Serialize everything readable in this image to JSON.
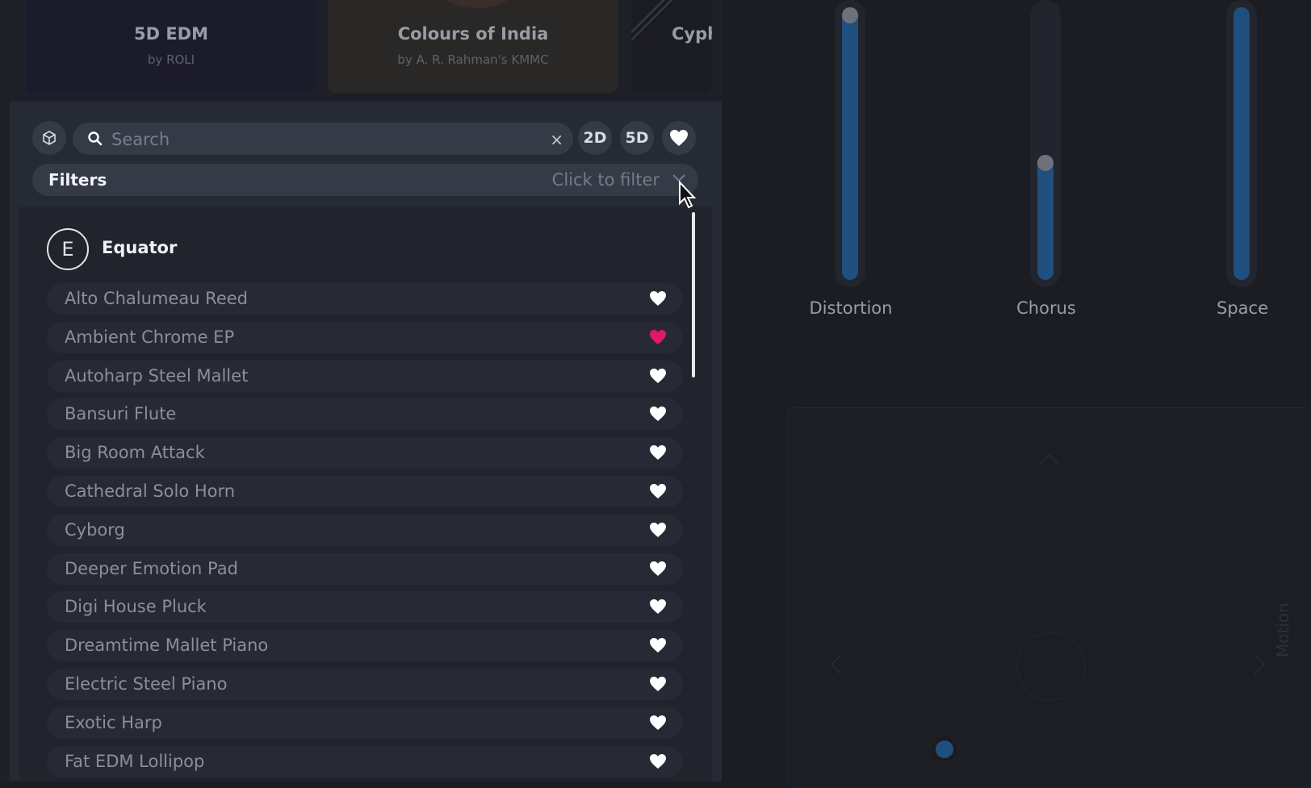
{
  "packs": [
    {
      "title": "5D EDM",
      "subtitle": "by ROLI"
    },
    {
      "title": "Colours of India",
      "subtitle": "by A. R. Rahman's KMMC"
    },
    {
      "title": "Cyph",
      "subtitle": ""
    }
  ],
  "toolbar": {
    "search_placeholder": "Search",
    "search_value": "",
    "clear_glyph": "×",
    "btn_2d": "2D",
    "btn_5d": "5D"
  },
  "filters": {
    "label": "Filters",
    "hint": "Click to filter"
  },
  "group": {
    "initial": "E",
    "name": "Equator"
  },
  "presets": [
    {
      "name": "Alto Chalumeau Reed",
      "favorite": false
    },
    {
      "name": "Ambient Chrome EP",
      "favorite": true
    },
    {
      "name": "Autoharp Steel Mallet",
      "favorite": false
    },
    {
      "name": "Bansuri Flute",
      "favorite": false
    },
    {
      "name": "Big Room Attack",
      "favorite": false
    },
    {
      "name": "Cathedral Solo Horn",
      "favorite": false
    },
    {
      "name": "Cyborg",
      "favorite": false
    },
    {
      "name": "Deeper Emotion Pad",
      "favorite": false
    },
    {
      "name": "Digi House Pluck",
      "favorite": false
    },
    {
      "name": "Dreamtime Mallet Piano",
      "favorite": false
    },
    {
      "name": "Electric Steel Piano",
      "favorite": false
    },
    {
      "name": "Exotic Harp",
      "favorite": false
    },
    {
      "name": "Fat EDM Lollipop",
      "favorite": false
    }
  ],
  "macros": [
    {
      "label": "Distortion",
      "level": 1.0
    },
    {
      "label": "Chorus",
      "level": 0.46
    },
    {
      "label": "Space",
      "level": 1.0
    }
  ],
  "pad": {
    "label": "Motion"
  },
  "colors": {
    "accent_blue": "#1f4f7f",
    "favorite_pink": "#e0176a",
    "heart_white": "#ffffff"
  }
}
